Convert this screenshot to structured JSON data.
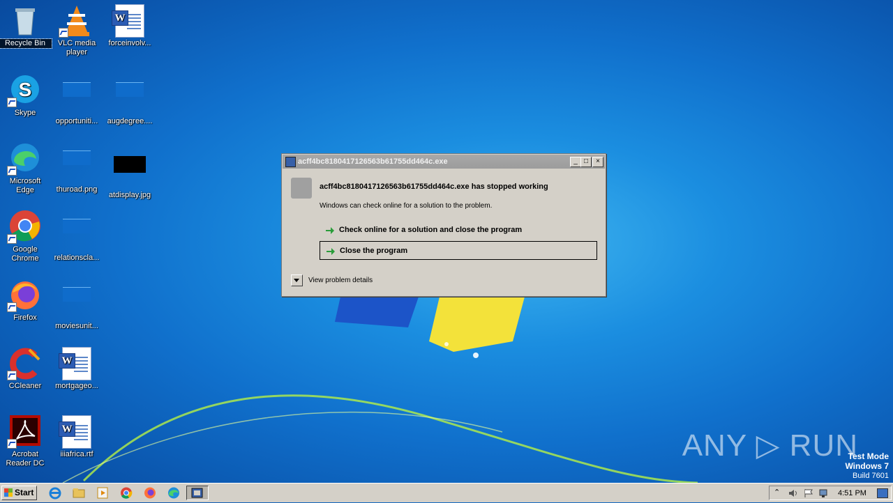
{
  "desktop": {
    "icons": [
      {
        "label": "Recycle Bin",
        "icon": "recycle-bin-icon"
      },
      {
        "label": "VLC media player",
        "icon": "vlc-icon"
      },
      {
        "label": "forceinvolv...",
        "icon": "word-doc-icon"
      },
      {
        "label": "Skype",
        "icon": "skype-icon"
      },
      {
        "label": "opportuniti...",
        "icon": "file-icon"
      },
      {
        "label": "augdegree....",
        "icon": "file-icon"
      },
      {
        "label": "Microsoft Edge",
        "icon": "edge-icon"
      },
      {
        "label": "thuroad.png",
        "icon": "image-file-icon"
      },
      {
        "label": "atdisplay.jpg",
        "icon": "image-file-icon"
      },
      {
        "label": "Google Chrome",
        "icon": "chrome-icon"
      },
      {
        "label": "relationscla...",
        "icon": "file-icon"
      },
      {
        "label": "Firefox",
        "icon": "firefox-icon"
      },
      {
        "label": "moviesunit...",
        "icon": "file-icon"
      },
      {
        "label": "CCleaner",
        "icon": "ccleaner-icon"
      },
      {
        "label": "mortgageo...",
        "icon": "word-doc-icon"
      },
      {
        "label": "Acrobat Reader DC",
        "icon": "acrobat-icon"
      },
      {
        "label": "iiiafrica.rtf",
        "icon": "word-doc-icon"
      }
    ]
  },
  "dialog": {
    "title": "acff4bc8180417126563b61755dd464c.exe",
    "heading": "acff4bc8180417126563b61755dd464c.exe has stopped working",
    "subtext": "Windows can check online for a solution to the problem.",
    "option_check_online": "Check online for a solution and close the program",
    "option_close": "Close the program",
    "details_label": "View problem details",
    "minimize": "_",
    "maximize": "□",
    "close": "×"
  },
  "taskbar": {
    "start_label": "Start",
    "clock": "4:51 PM",
    "apps": [
      "ie-icon",
      "explorer-icon",
      "media-player-icon",
      "chrome-icon",
      "firefox-icon",
      "edge-icon",
      "error-dialog-icon"
    ]
  },
  "watermark": {
    "text": "ANY ▷ RUN"
  },
  "system_notice": {
    "line1": "Test Mode",
    "line2": "Windows 7",
    "line3": "Build 7601"
  }
}
